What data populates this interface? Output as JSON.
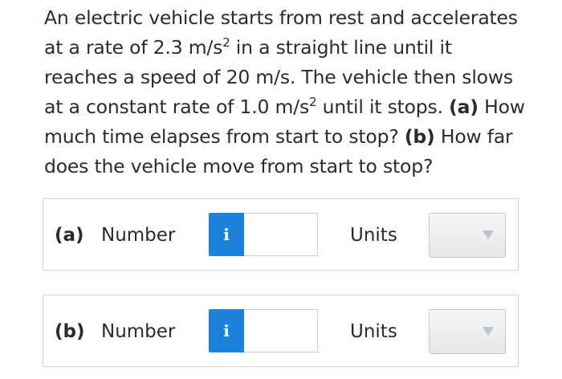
{
  "question": {
    "line1": "An electric vehicle starts from rest and accelerates",
    "line2_before": "at a rate of 2.3 m/s",
    "line2_sup": "2",
    "line2_after": " in a straight line until it",
    "line3": "reaches a speed of 20 m/s. The vehicle then slows",
    "line4_before": "at a constant rate of 1.0 m/s",
    "line4_sup": "2",
    "line4_after": " until it stops. ",
    "line4_part_a": "(a)",
    "line4_end": " How",
    "line5_before": "much time elapses from start to stop? ",
    "line5_part_b": "(b)",
    "line5_after": " How far",
    "line6": "does the vehicle move from start to stop?"
  },
  "parts": [
    {
      "label": "(a)",
      "number_label": "Number",
      "info_icon": "i",
      "number_value": "",
      "units_label": "Units",
      "units_value": ""
    },
    {
      "label": "(b)",
      "number_label": "Number",
      "info_icon": "i",
      "number_value": "",
      "units_label": "Units",
      "units_value": ""
    }
  ],
  "colors": {
    "info_button": "#1a82d8",
    "text": "#2b2b2b",
    "border": "#d6d6d6"
  }
}
